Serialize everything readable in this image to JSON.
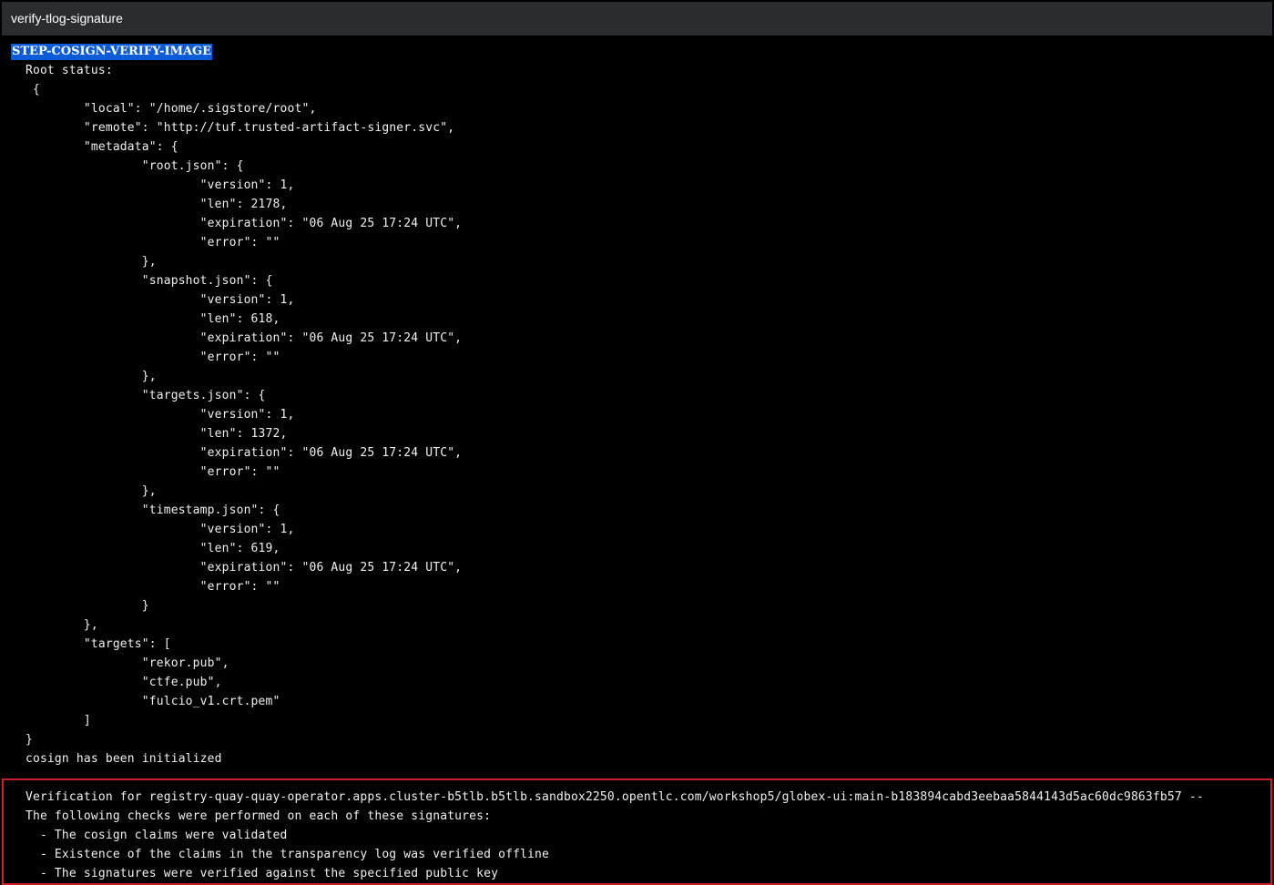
{
  "window": {
    "title": "verify-tlog-signature"
  },
  "log": {
    "step_header": "STEP-COSIGN-VERIFY-IMAGE",
    "lines": [
      "  Root status:",
      "   {",
      "          \"local\": \"/home/.sigstore/root\",",
      "          \"remote\": \"http://tuf.trusted-artifact-signer.svc\",",
      "          \"metadata\": {",
      "                  \"root.json\": {",
      "                          \"version\": 1,",
      "                          \"len\": 2178,",
      "                          \"expiration\": \"06 Aug 25 17:24 UTC\",",
      "                          \"error\": \"\"",
      "                  },",
      "                  \"snapshot.json\": {",
      "                          \"version\": 1,",
      "                          \"len\": 618,",
      "                          \"expiration\": \"06 Aug 25 17:24 UTC\",",
      "                          \"error\": \"\"",
      "                  },",
      "                  \"targets.json\": {",
      "                          \"version\": 1,",
      "                          \"len\": 1372,",
      "                          \"expiration\": \"06 Aug 25 17:24 UTC\",",
      "                          \"error\": \"\"",
      "                  },",
      "                  \"timestamp.json\": {",
      "                          \"version\": 1,",
      "                          \"len\": 619,",
      "                          \"expiration\": \"06 Aug 25 17:24 UTC\",",
      "                          \"error\": \"\"",
      "                  }",
      "          },",
      "          \"targets\": [",
      "                  \"rekor.pub\",",
      "                  \"ctfe.pub\",",
      "                  \"fulcio_v1.crt.pem\"",
      "          ]",
      "  }",
      "  cosign has been initialized",
      "",
      "  Verification for registry-quay-quay-operator.apps.cluster-b5tlb.b5tlb.sandbox2250.opentlc.com/workshop5/globex-ui:main-b183894cabd3eebaa5844143d5ac60dc9863fb57 --",
      "  The following checks were performed on each of these signatures:",
      "    - The cosign claims were validated",
      "    - Existence of the claims in the transparency log was verified offline",
      "    - The signatures were verified against the specified public key"
    ]
  },
  "colors": {
    "background": "#000000",
    "title_bar": "#2a2c30",
    "selection_highlight": "#0b5cd6",
    "verification_border": "#d11f27",
    "text": "#f0f0f0"
  }
}
